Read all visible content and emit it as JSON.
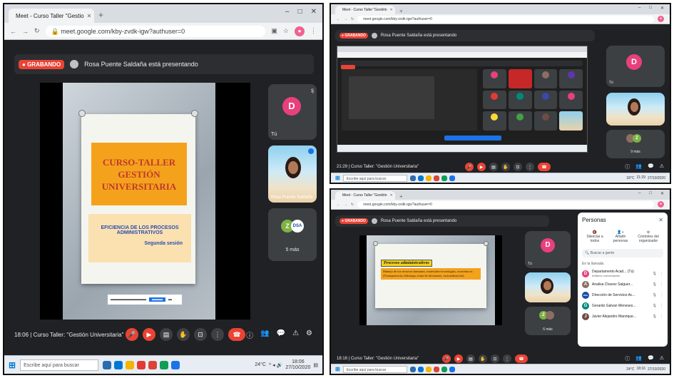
{
  "colors": {
    "recording_red": "#ea4335",
    "meet_dark": "#202124",
    "tile_gray": "#3c4043",
    "avatar_pink": "#e8407a",
    "slide_orange": "#f4a21c"
  },
  "frame1": {
    "tab_title": "Meet - Curso Taller \"Gestio",
    "url": "meet.google.com/kby-zvdk-igw?authuser=0",
    "recording_label": "GRABANDO",
    "presenting_text": "Rosa Puente Saldaña está presentando",
    "slide": {
      "title_line1": "CURSO-TALLER",
      "title_line2": "GESTIÓN UNIVERSITARIA",
      "subtitle": "EFICIENCIA DE LOS PROCESOS ADMINISTRATIVOS",
      "session": "Segunda sesión"
    },
    "tiles": {
      "avatar_letter": "D",
      "avatar_name": "Tú",
      "video_name": "Rosa Puente Saldaña",
      "more_label": "5 más",
      "more_initial_1": "Z",
      "more_initial_2": "DSA"
    },
    "meeting_time": "18:06",
    "meeting_title": "Curso Taller: \"Gestión Universitaria\"",
    "taskbar": {
      "search_placeholder": "Escribe aquí para buscar",
      "weather": "24°C",
      "time": "18:06",
      "date": "27/10/2020"
    }
  },
  "frame2": {
    "tab_title": "Meet - Curso Taller \"Gestión",
    "url": "meet.google.com/kby-zvdk-igw?authuser=0",
    "recording_label": "GRABANDO",
    "presenting_text": "Rosa Puente Saldaña está presentando",
    "tiles": {
      "avatar_letter": "D",
      "avatar_name": "Tú",
      "more_label": "9 más",
      "more_initial": "Z"
    },
    "meeting_time": "21:29",
    "meeting_title": "Curso Taller: \"Gestión Universitaria\"",
    "taskbar": {
      "search_placeholder": "Escribe aquí para buscar",
      "weather": "18°C",
      "time": "21:29",
      "date": "27/10/2020"
    }
  },
  "frame3": {
    "tab_title": "Meet - Curso Taller \"Gestión",
    "url": "meet.google.com/kby-zvdk-igw?authuser=0",
    "recording_label": "GRABANDO",
    "presenting_text": "Rosa Puente Saldaña está presentando",
    "slide": {
      "title": "Procesos administrativos",
      "body": "Manejo de los recursos humanos, materiales-tecnologías, económicos (Transparencia, liderazgo, toma de decisiones, racionalización)"
    },
    "tiles": {
      "avatar_letter": "D",
      "avatar_name": "Tú",
      "more_label": "6 más",
      "more_initial": "Z"
    },
    "people": {
      "title": "Personas",
      "actions": [
        "Silenciar a todos",
        "Añadir personas",
        "Controles del organizador"
      ],
      "search_placeholder": "Buscar a gente",
      "section": "En la llamada",
      "list": [
        {
          "name": "Departamento Acad... (Tú)",
          "sub": "Anfitrión conversación",
          "initial": "D",
          "color": "#e8407a"
        },
        {
          "name": "Analisa Chavez Salguer...",
          "sub": "",
          "initial": "A",
          "color": "#8d6e63"
        },
        {
          "name": "Dirección de Servicios Ac...",
          "sub": "",
          "initial": "DSA",
          "color": "#1a4aa8"
        },
        {
          "name": "Gerardo Galvan Meneses...",
          "sub": "",
          "initial": "G",
          "color": "#00897b"
        },
        {
          "name": "Javier Alejandro Manrique...",
          "sub": "",
          "initial": "J",
          "color": "#6d4c41"
        }
      ]
    },
    "meeting_time": "18:16",
    "meeting_title": "Curso Taller: \"Gestión Universitaria\"",
    "taskbar": {
      "search_placeholder": "Escribe aquí para buscar",
      "weather": "24°C",
      "time": "18:16",
      "date": "27/10/2020"
    }
  }
}
